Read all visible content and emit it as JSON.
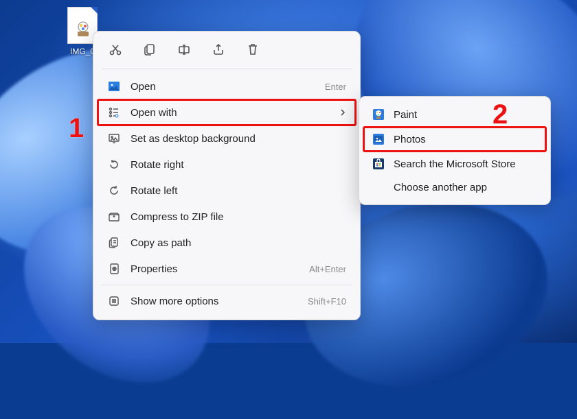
{
  "file": {
    "label": "IMG_0"
  },
  "toolbar": {
    "cut": "cut-icon",
    "copy": "copy-icon",
    "rename": "rename-icon",
    "share": "share-icon",
    "delete": "delete-icon"
  },
  "menu": {
    "open": {
      "label": "Open",
      "shortcut": "Enter"
    },
    "openwith": {
      "label": "Open with"
    },
    "setbg": {
      "label": "Set as desktop background"
    },
    "rotr": {
      "label": "Rotate right"
    },
    "rotl": {
      "label": "Rotate left"
    },
    "zip": {
      "label": "Compress to ZIP file"
    },
    "copypath": {
      "label": "Copy as path"
    },
    "props": {
      "label": "Properties",
      "shortcut": "Alt+Enter"
    },
    "more": {
      "label": "Show more options",
      "shortcut": "Shift+F10"
    }
  },
  "submenu": {
    "paint": {
      "label": "Paint"
    },
    "photos": {
      "label": "Photos"
    },
    "store": {
      "label": "Search the Microsoft Store"
    },
    "choose": {
      "label": "Choose another app"
    }
  },
  "annotations": {
    "one": "1",
    "two": "2"
  },
  "colors": {
    "highlight": "#e11"
  }
}
